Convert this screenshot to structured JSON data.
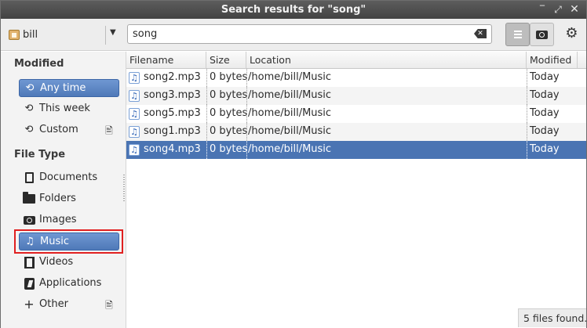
{
  "window": {
    "title": "Search results for \"song\"",
    "controls": {
      "minimize": "‾",
      "maximize": "⤢",
      "close": "✕"
    }
  },
  "toolbar": {
    "folder": "bill",
    "search_query": "song",
    "list_view_active": true,
    "icons": [
      "home-folder-icon",
      "dropdown-arrow-icon",
      "clear-search-icon",
      "list-view-icon",
      "thumbnail-view-icon",
      "gear-icon"
    ]
  },
  "sidebar": {
    "modified_heading": "Modified",
    "modified_items": [
      {
        "label": "Any time",
        "icon": "history-icon",
        "selected": true
      },
      {
        "label": "This week",
        "icon": "history-icon",
        "selected": false
      },
      {
        "label": "Custom",
        "icon": "history-icon",
        "selected": false,
        "side_icon": "edit-document-icon"
      }
    ],
    "filetype_heading": "File Type",
    "filetype_items": [
      {
        "label": "Documents",
        "icon": "document-icon",
        "selected": false
      },
      {
        "label": "Folders",
        "icon": "folder-icon",
        "selected": false
      },
      {
        "label": "Images",
        "icon": "camera-icon",
        "selected": false
      },
      {
        "label": "Music",
        "icon": "music-note-icon",
        "selected": true
      },
      {
        "label": "Videos",
        "icon": "film-icon",
        "selected": false
      },
      {
        "label": "Applications",
        "icon": "application-icon",
        "selected": false
      },
      {
        "label": "Other",
        "icon": "plus-icon",
        "selected": false,
        "side_icon": "edit-document-icon"
      }
    ]
  },
  "filelist": {
    "columns": [
      "Filename",
      "Size",
      "Location",
      "Modified"
    ],
    "rows": [
      {
        "name": "song2.mp3",
        "size": "0 bytes",
        "location": "/home/bill/Music",
        "modified": "Today",
        "selected": false
      },
      {
        "name": "song3.mp3",
        "size": "0 bytes",
        "location": "/home/bill/Music",
        "modified": "Today",
        "selected": false
      },
      {
        "name": "song5.mp3",
        "size": "0 bytes",
        "location": "/home/bill/Music",
        "modified": "Today",
        "selected": false
      },
      {
        "name": "song1.mp3",
        "size": "0 bytes",
        "location": "/home/bill/Music",
        "modified": "Today",
        "selected": false
      },
      {
        "name": "song4.mp3",
        "size": "0 bytes",
        "location": "/home/bill/Music",
        "modified": "Today",
        "selected": true
      }
    ]
  },
  "status": {
    "text": "5 files found."
  },
  "colors": {
    "selection": "#4a74b3",
    "titlebar": "#4a4a4a",
    "annotation_box": "#e02020"
  }
}
